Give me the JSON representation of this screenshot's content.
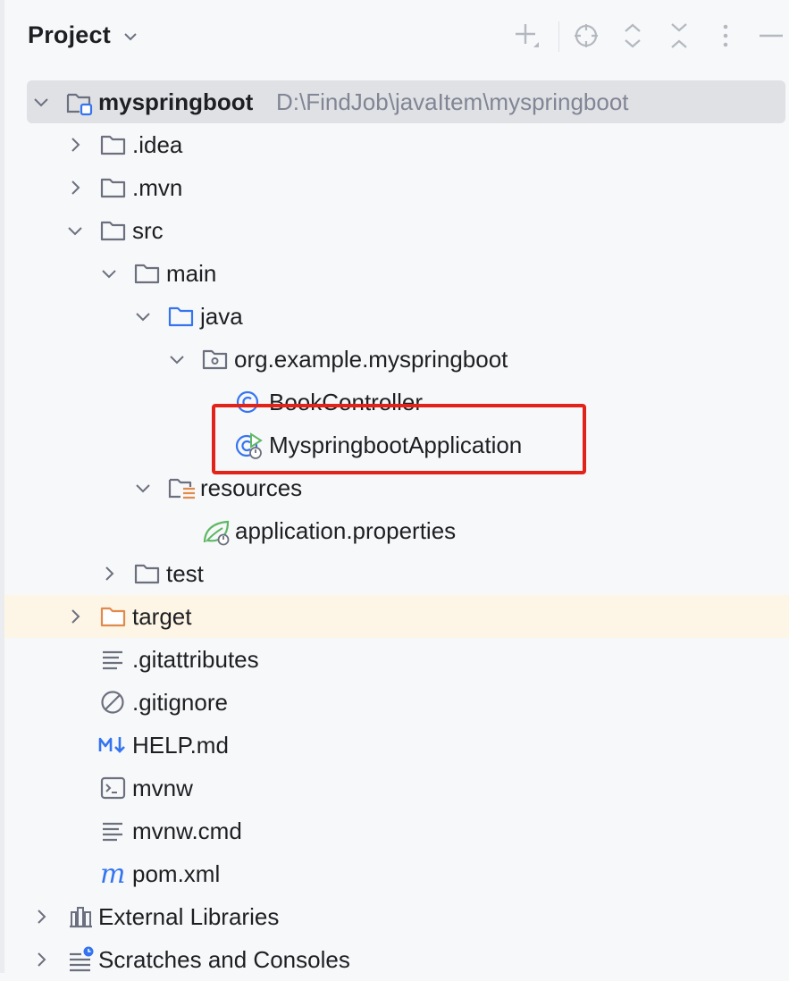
{
  "header": {
    "title": "Project",
    "toolbar": [
      "add-icon",
      "locate-icon",
      "expand-all-icon",
      "collapse-all-icon",
      "more-icon",
      "hide-icon"
    ]
  },
  "tree": {
    "root": {
      "label": "myspringboot",
      "path": "D:\\FindJob\\javaItem\\myspringboot"
    },
    "idea": ".idea",
    "mvn": ".mvn",
    "src": "src",
    "main": "main",
    "java": "java",
    "package": "org.example.myspringboot",
    "book_controller": "BookController",
    "app": "MyspringbootApplication",
    "resources": "resources",
    "app_props": "application.properties",
    "test": "test",
    "target": "target",
    "gitattributes": ".gitattributes",
    "gitignore": ".gitignore",
    "help": "HELP.md",
    "mvnw": "mvnw",
    "mvnw_cmd": "mvnw.cmd",
    "pom": "pom.xml",
    "ext_libs": "External Libraries",
    "scratches": "Scratches and Consoles"
  },
  "colors": {
    "selection": "#dfe1e5",
    "highlight_row": "#fdf5e6",
    "annotation_box": "#e2231a",
    "icon_blue": "#3574f0",
    "icon_green": "#5fb865",
    "folder_orange": "#e08a4b"
  }
}
